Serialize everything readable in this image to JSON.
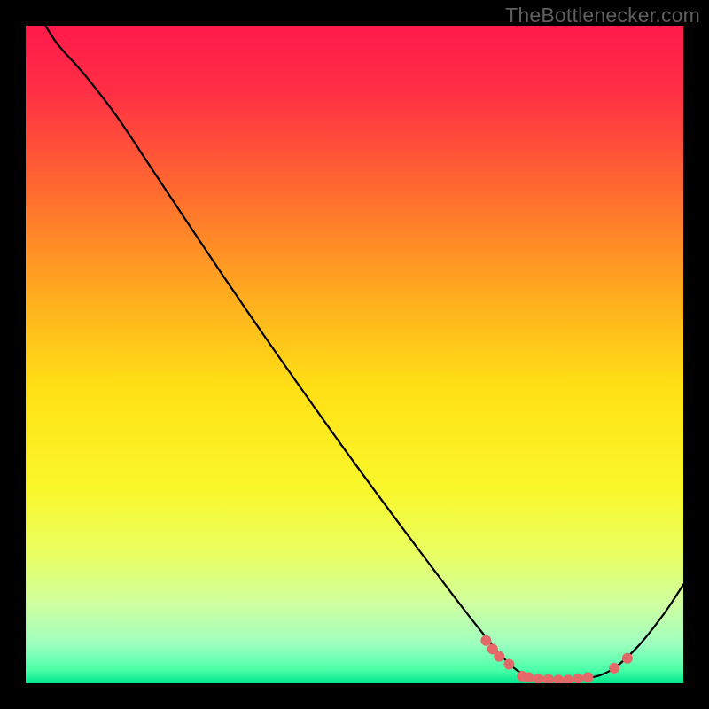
{
  "watermark": "TheBottlenecker.com",
  "chart_data": {
    "type": "line",
    "title": "",
    "xlabel": "",
    "ylabel": "",
    "xlim": [
      0,
      100
    ],
    "ylim": [
      0,
      100
    ],
    "background_gradient": {
      "stops": [
        {
          "offset": 0.0,
          "color": "#ff1a4b"
        },
        {
          "offset": 0.1,
          "color": "#ff2f45"
        },
        {
          "offset": 0.25,
          "color": "#ff6a30"
        },
        {
          "offset": 0.4,
          "color": "#ffa820"
        },
        {
          "offset": 0.55,
          "color": "#ffe015"
        },
        {
          "offset": 0.7,
          "color": "#faf72a"
        },
        {
          "offset": 0.8,
          "color": "#eaff60"
        },
        {
          "offset": 0.88,
          "color": "#cfffa0"
        },
        {
          "offset": 0.94,
          "color": "#9effc0"
        },
        {
          "offset": 0.98,
          "color": "#4affa8"
        },
        {
          "offset": 1.0,
          "color": "#00e58b"
        }
      ]
    },
    "series": [
      {
        "name": "bottleneck-curve",
        "stroke": "#000000",
        "stroke_width": 2.2,
        "points": [
          {
            "x": 3.0,
            "y": 100.0
          },
          {
            "x": 5.0,
            "y": 97.0
          },
          {
            "x": 9.0,
            "y": 92.5
          },
          {
            "x": 14.0,
            "y": 86.0
          },
          {
            "x": 20.0,
            "y": 77.0
          },
          {
            "x": 30.0,
            "y": 62.0
          },
          {
            "x": 40.0,
            "y": 47.5
          },
          {
            "x": 50.0,
            "y": 33.5
          },
          {
            "x": 60.0,
            "y": 20.0
          },
          {
            "x": 68.0,
            "y": 9.5
          },
          {
            "x": 73.0,
            "y": 3.5
          },
          {
            "x": 76.0,
            "y": 1.3
          },
          {
            "x": 80.0,
            "y": 0.5
          },
          {
            "x": 85.0,
            "y": 0.7
          },
          {
            "x": 89.0,
            "y": 2.0
          },
          {
            "x": 93.0,
            "y": 5.5
          },
          {
            "x": 97.0,
            "y": 10.5
          },
          {
            "x": 100.0,
            "y": 15.0
          }
        ]
      },
      {
        "name": "flat-region-markers",
        "stroke": "#e46a6a",
        "marker": "dot",
        "marker_radius": 6,
        "points": [
          {
            "x": 70.0,
            "y": 6.5
          },
          {
            "x": 71.0,
            "y": 5.2
          },
          {
            "x": 72.0,
            "y": 4.1
          },
          {
            "x": 73.5,
            "y": 2.9
          },
          {
            "x": 75.5,
            "y": 1.1
          },
          {
            "x": 76.5,
            "y": 0.9
          },
          {
            "x": 78.0,
            "y": 0.7
          },
          {
            "x": 79.5,
            "y": 0.6
          },
          {
            "x": 81.0,
            "y": 0.5
          },
          {
            "x": 82.5,
            "y": 0.5
          },
          {
            "x": 84.0,
            "y": 0.7
          },
          {
            "x": 85.5,
            "y": 0.9
          },
          {
            "x": 89.5,
            "y": 2.3
          },
          {
            "x": 91.5,
            "y": 3.8
          }
        ]
      }
    ]
  }
}
